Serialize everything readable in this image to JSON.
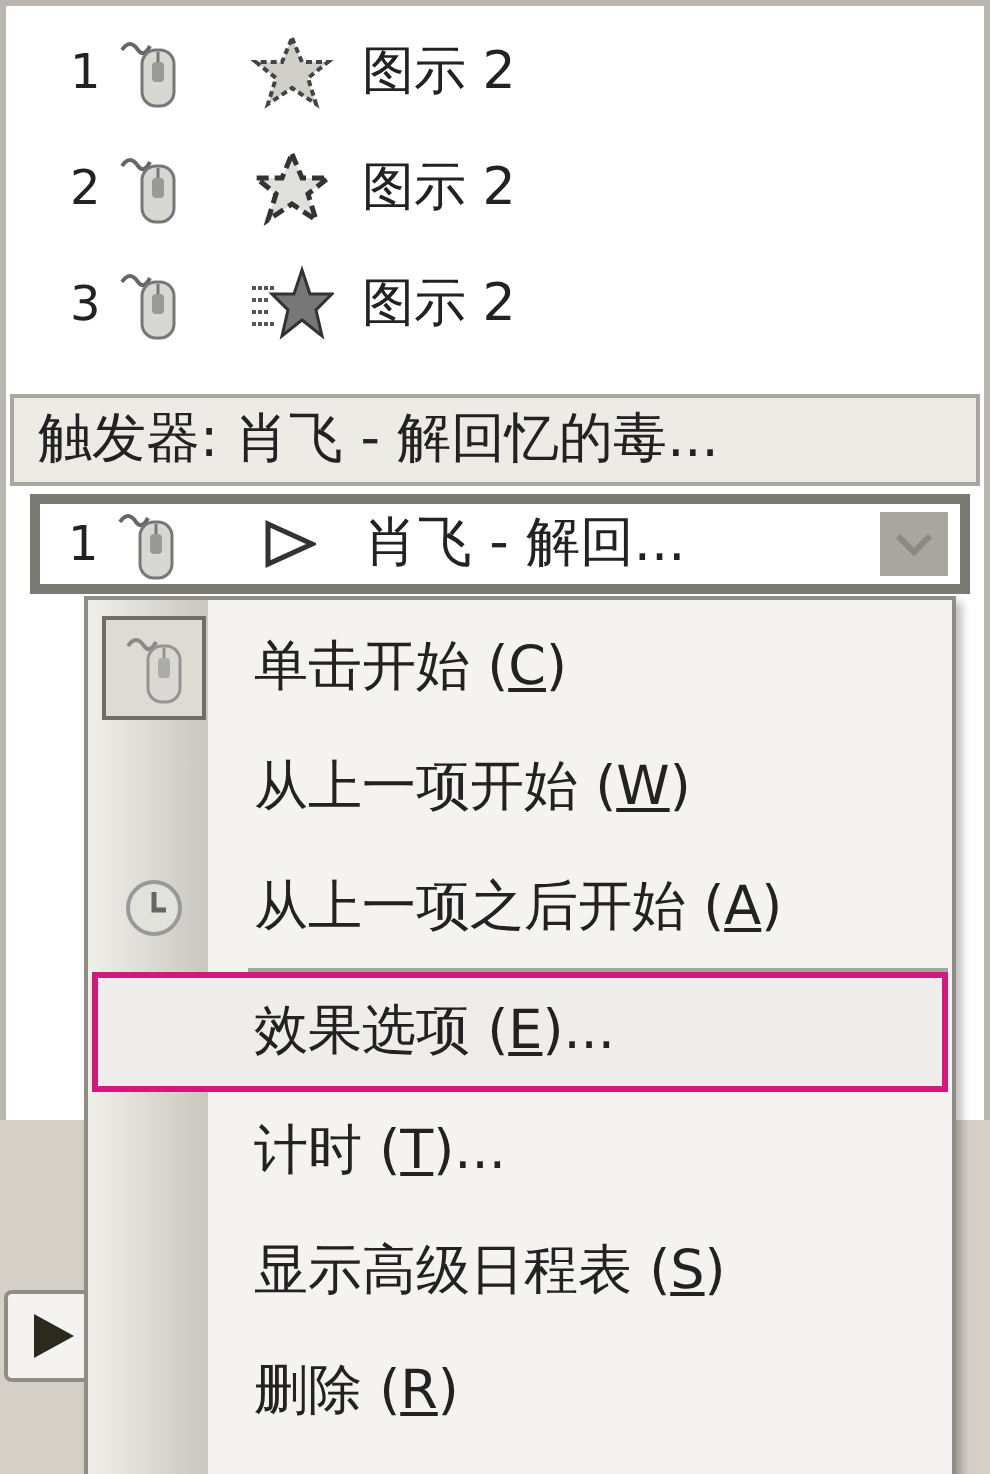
{
  "animation_list": {
    "items": [
      {
        "number": "1",
        "label": "图示 2"
      },
      {
        "number": "2",
        "label": "图示 2"
      },
      {
        "number": "3",
        "label": "图示 2"
      }
    ],
    "trigger_header": "触发器: 肖飞 - 解回忆的毒...",
    "selected_item": {
      "number": "1",
      "label": "肖飞 - 解回...",
      "selected": true
    }
  },
  "context_menu": {
    "items": [
      {
        "before": "单击开始 (",
        "key": "C",
        "after": ")",
        "checked": true,
        "selected": false,
        "divider_above": false
      },
      {
        "before": "从上一项开始 (",
        "key": "W",
        "after": ")",
        "checked": false,
        "selected": false,
        "divider_above": false
      },
      {
        "before": "从上一项之后开始 (",
        "key": "A",
        "after": ")",
        "checked": false,
        "selected": false,
        "divider_above": false
      },
      {
        "before": "效果选项 (",
        "key": "E",
        "after": ")...",
        "checked": false,
        "selected": true,
        "divider_above": true
      },
      {
        "before": "计时 (",
        "key": "T",
        "after": ")...",
        "checked": false,
        "selected": false,
        "divider_above": false
      },
      {
        "before": "显示高级日程表 (",
        "key": "S",
        "after": ")",
        "checked": false,
        "selected": false,
        "divider_above": false
      },
      {
        "before": "删除 (",
        "key": "R",
        "after": ")",
        "checked": false,
        "selected": false,
        "divider_above": false
      }
    ]
  }
}
